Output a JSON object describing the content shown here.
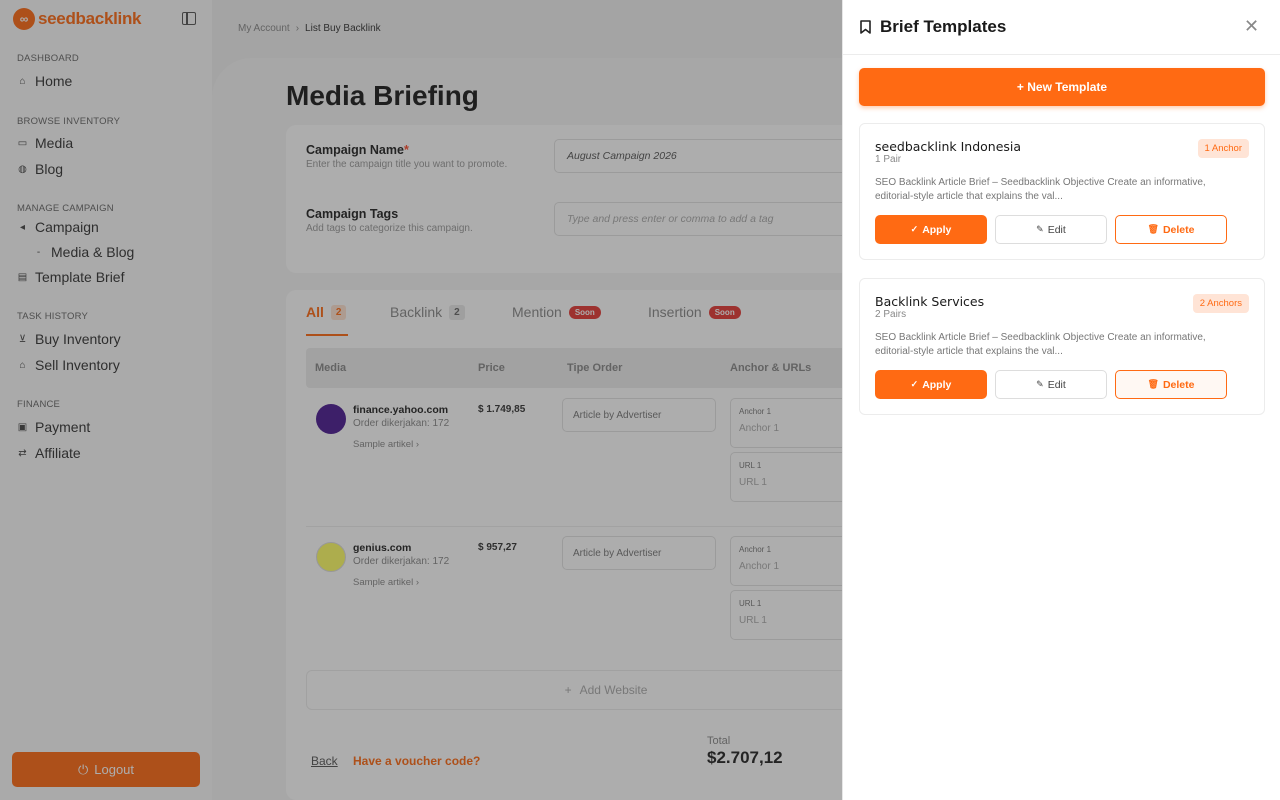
{
  "brand": {
    "name": "seedbacklink",
    "accent": "#ff6a13"
  },
  "sidebar": {
    "sections": [
      {
        "title": "DASHBOARD",
        "items": [
          {
            "label": "Home",
            "icon": "home-icon"
          }
        ]
      },
      {
        "title": "BROWSE INVENTORY",
        "items": [
          {
            "label": "Media",
            "icon": "monitor-icon"
          },
          {
            "label": "Blog",
            "icon": "globe-icon"
          }
        ]
      },
      {
        "title": "MANAGE CAMPAIGN",
        "items": [
          {
            "label": "Campaign",
            "icon": "megaphone-icon"
          },
          {
            "label": "Media & Blog",
            "icon": ""
          },
          {
            "label": "Template Brief",
            "icon": "document-icon"
          }
        ]
      },
      {
        "title": "TASK HISTORY",
        "items": [
          {
            "label": "Buy Inventory",
            "icon": "cart-icon"
          },
          {
            "label": "Sell Inventory",
            "icon": "store-icon"
          }
        ]
      },
      {
        "title": "FINANCE",
        "items": [
          {
            "label": "Payment",
            "icon": "wallet-icon"
          },
          {
            "label": "Affiliate",
            "icon": "affiliate-icon"
          }
        ]
      }
    ],
    "logout_label": "Logout"
  },
  "breadcrumb": {
    "parent": "My Account",
    "current": "List Buy Backlink"
  },
  "page": {
    "title": "Media Briefing",
    "campaign_name_label": "Campaign Name",
    "campaign_name_help": "Enter the campaign title you want to promote.",
    "campaign_name_value": "August Campaign 2026",
    "campaign_tags_label": "Campaign Tags",
    "campaign_tags_help": "Add tags to categorize this campaign.",
    "campaign_tags_placeholder": "Type and press enter or comma to add a tag"
  },
  "tabs": [
    {
      "label": "All",
      "count": "2"
    },
    {
      "label": "Backlink",
      "count": "2"
    },
    {
      "label": "Mention",
      "badge": "Soon"
    },
    {
      "label": "Insertion",
      "badge": "Soon"
    }
  ],
  "table": {
    "columns": [
      "Media",
      "Price",
      "Tipe Order",
      "Anchor & URLs"
    ],
    "rows": [
      {
        "name": "finance.yahoo.com",
        "sub": "Order dikerjakan: 172",
        "sample": "Sample artikel",
        "price": "$ 1.749,85",
        "tipe": "Article by Advertiser",
        "anchor_label": "Anchor 1",
        "anchor_value": "Anchor 1",
        "url_label": "URL 1",
        "url_value": "URL 1"
      },
      {
        "name": "genius.com",
        "sub": "Order dikerjakan: 172",
        "sample": "Sample artikel",
        "price": "$ 957,27",
        "tipe": "Article by Advertiser",
        "anchor_label": "Anchor 1",
        "anchor_value": "Anchor 1",
        "url_label": "URL 1",
        "url_value": "URL 1"
      }
    ],
    "add_website_label": "Add Website"
  },
  "footer": {
    "back_label": "Back",
    "voucher_label": "Have a voucher code?",
    "total_label": "Total",
    "total_value": "$2.707,12"
  },
  "drawer": {
    "title": "Brief Templates",
    "new_template_label": "+ New Template",
    "templates": [
      {
        "name": "seedbacklink Indonesia",
        "pairs": "1 Pair",
        "badge": "1 Anchor",
        "description": "SEO Backlink Article Brief – Seedbacklink Objective Create an informative, editorial-style article that explains the val...",
        "apply": "Apply",
        "edit": "Edit",
        "delete": "Delete"
      },
      {
        "name": "Backlink Services",
        "pairs": "2 Pairs",
        "badge": "2 Anchors",
        "description": "SEO Backlink Article Brief – Seedbacklink Objective Create an informative, editorial-style article that explains the val...",
        "apply": "Apply",
        "edit": "Edit",
        "delete": "Delete"
      }
    ]
  }
}
